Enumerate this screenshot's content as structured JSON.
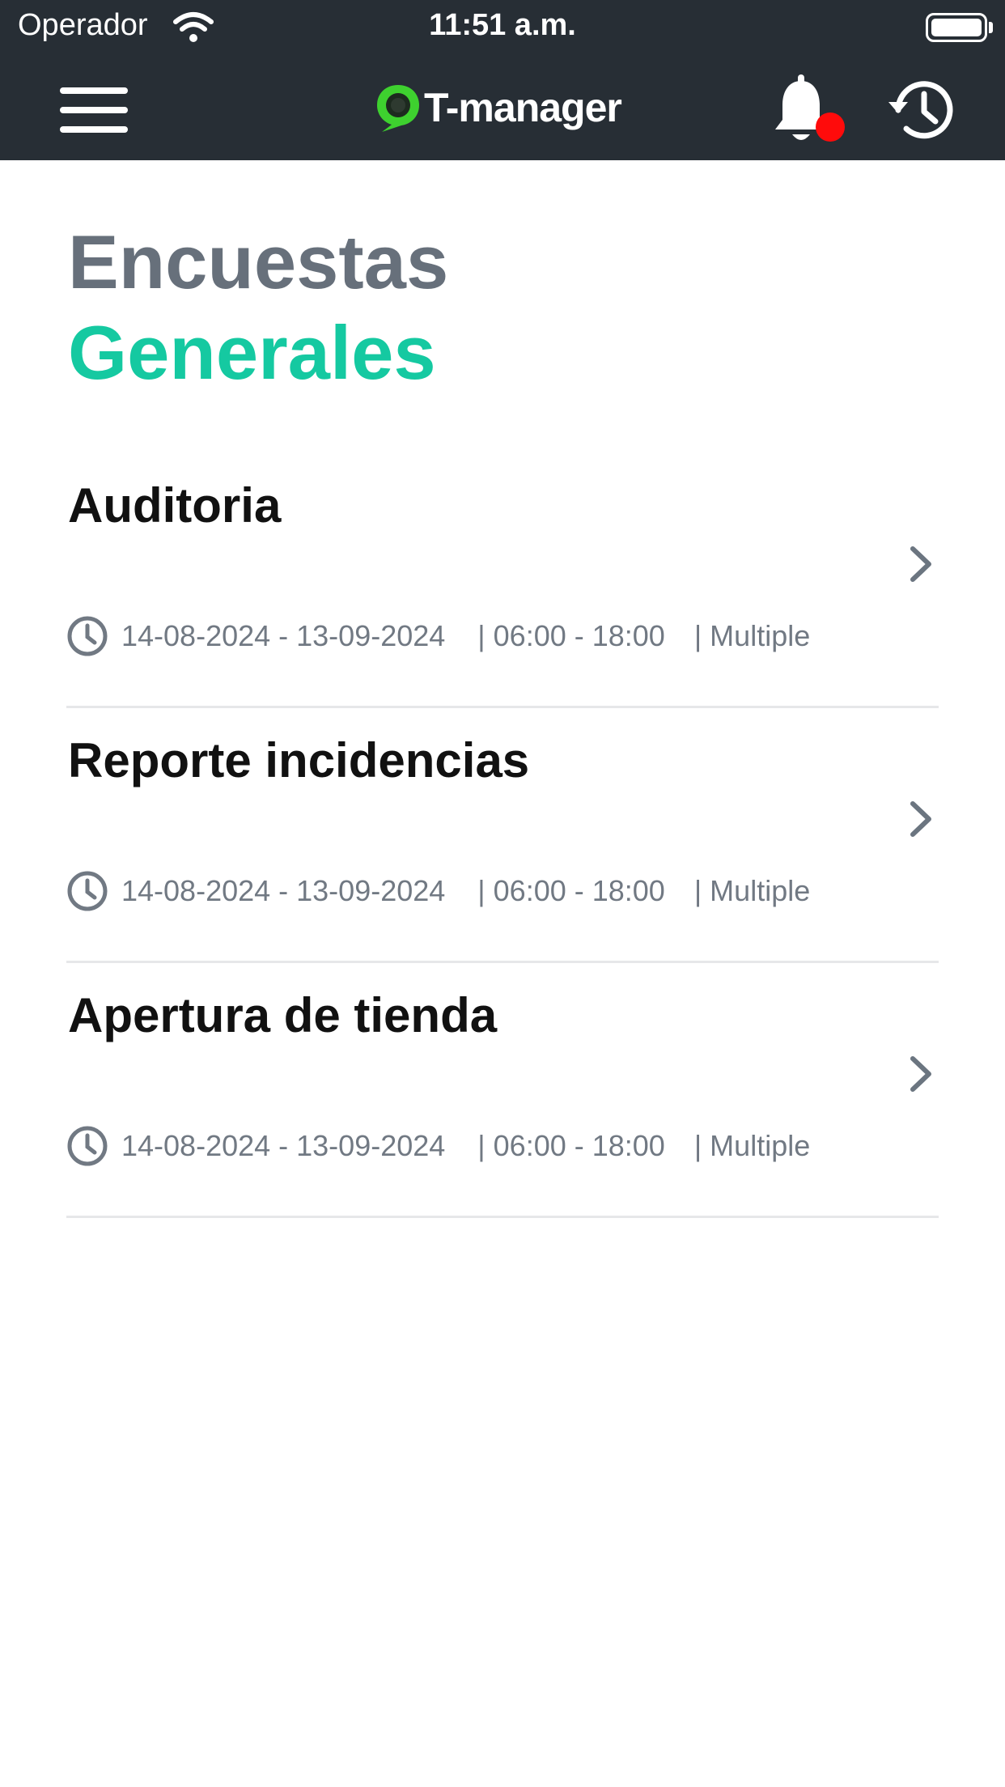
{
  "status_bar": {
    "carrier": "Operador",
    "time": "11:51 a.m."
  },
  "app": {
    "logo_text": "T-manager",
    "brand_color": "#15c9a1",
    "logo_color": "#3ed12f",
    "nav_icons": [
      "menu-icon",
      "bell-icon",
      "history-icon"
    ],
    "notification_badge_color": "#ff0b0b"
  },
  "page": {
    "title_line1": "Encuestas",
    "title_line2": "Generales"
  },
  "surveys": [
    {
      "title": "Auditoria",
      "date_range": "14-08-2024 - 13-09-2024",
      "hours": "| 06:00 - 18:00",
      "frequency": "| Multiple"
    },
    {
      "title": "Reporte incidencias",
      "date_range": "14-08-2024 - 13-09-2024",
      "hours": "| 06:00 - 18:00",
      "frequency": "| Multiple"
    },
    {
      "title": "Apertura de tienda",
      "date_range": "14-08-2024 - 13-09-2024",
      "hours": "| 06:00 - 18:00",
      "frequency": "| Multiple"
    }
  ]
}
